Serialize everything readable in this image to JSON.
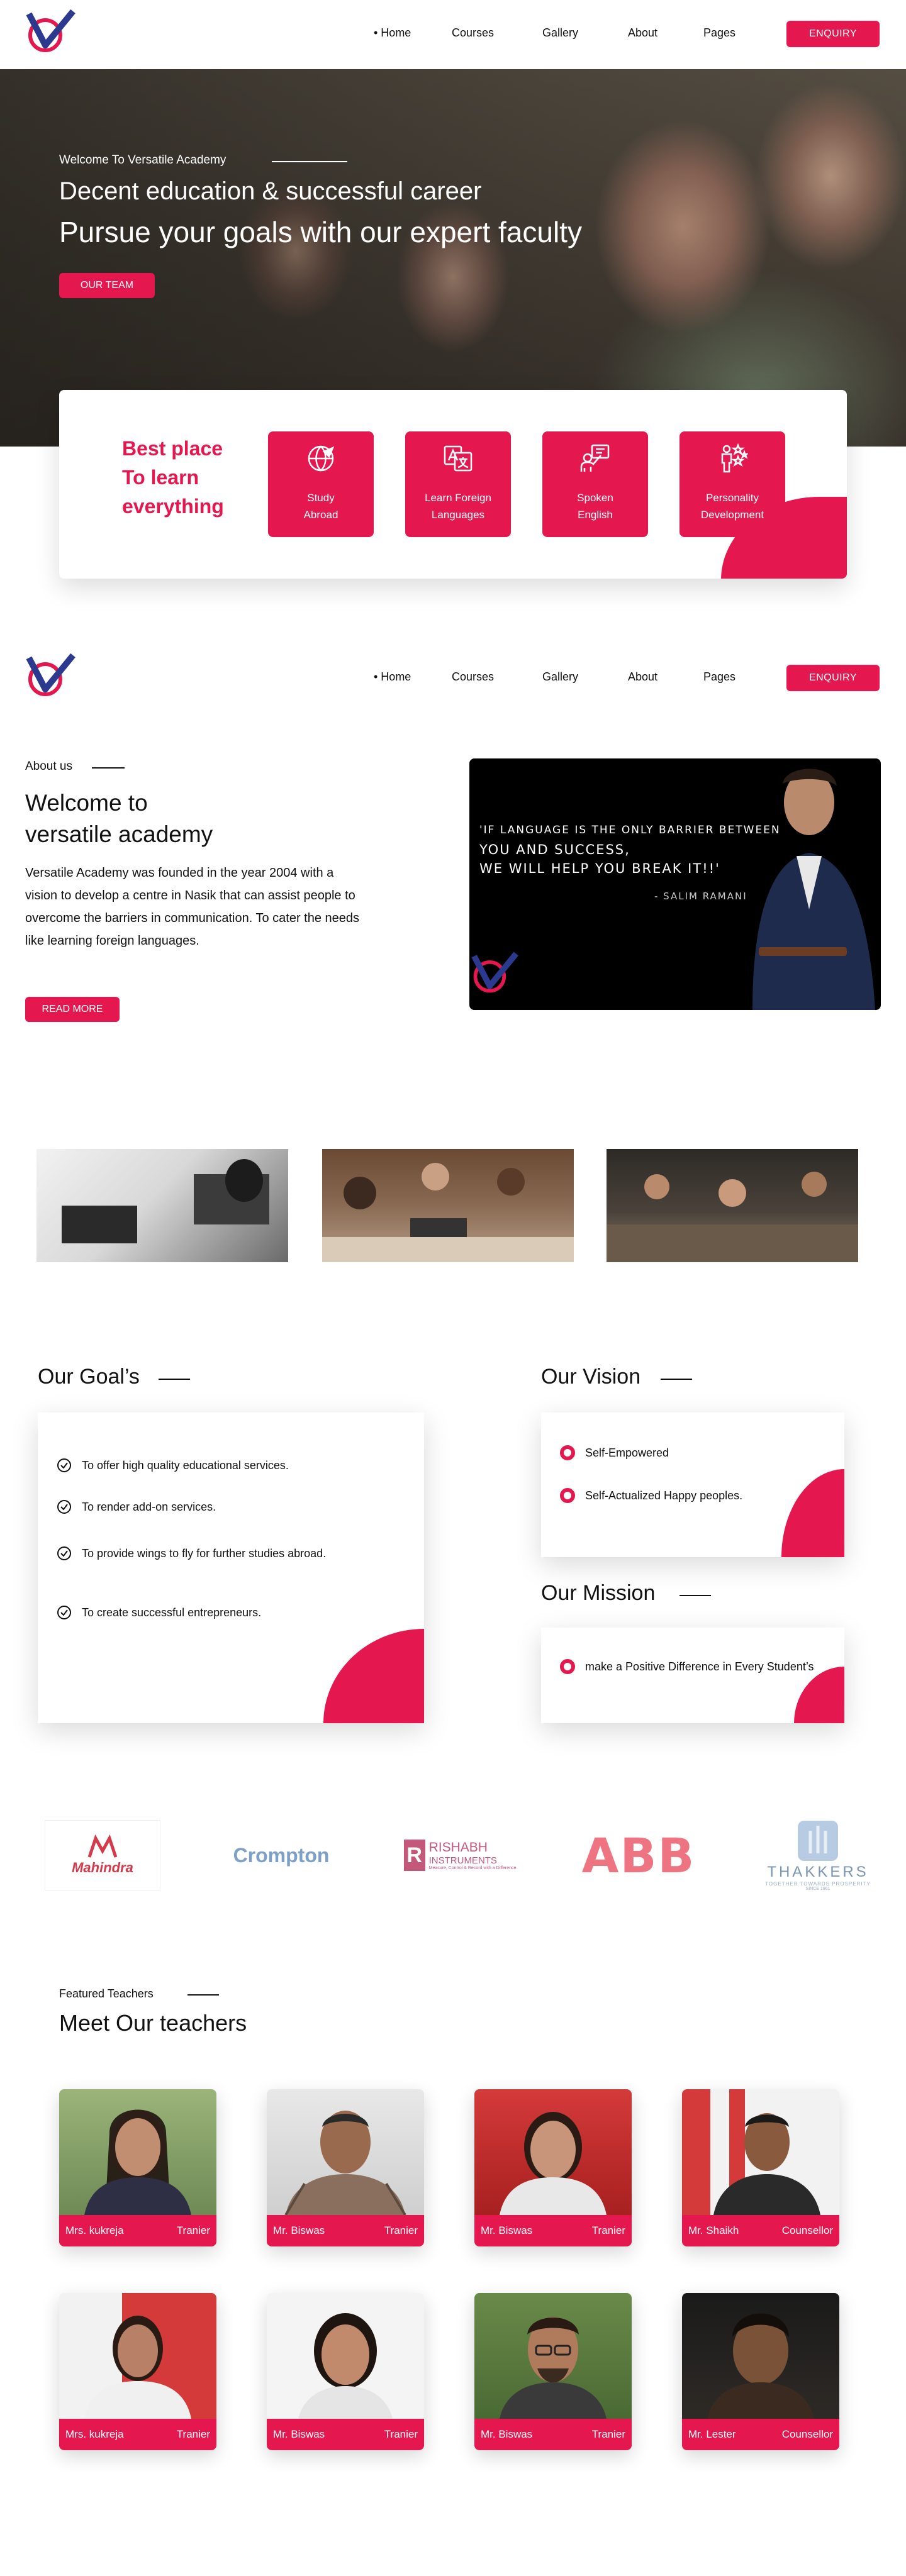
{
  "nav": {
    "items": [
      "• Home",
      "Courses",
      "Gallery",
      "About",
      "Pages"
    ],
    "enquiry": "ENQUIRY"
  },
  "hero": {
    "welcome": "Welcome To Versatile Academy",
    "heading1": "Decent education & successful career",
    "heading2": "Pursue your goals with our expert faculty",
    "button": "OUR TEAM"
  },
  "features": {
    "tagline": [
      "Best place",
      "To learn",
      "everything"
    ],
    "items": [
      {
        "line1": "Study",
        "line2": "Abroad",
        "icon": "globe-plane-icon"
      },
      {
        "line1": "Learn Foreign",
        "line2": "Languages",
        "icon": "translate-icon"
      },
      {
        "line1": "Spoken",
        "line2": "English",
        "icon": "speaker-board-icon"
      },
      {
        "line1": "Personality",
        "line2": "Development",
        "icon": "person-stars-icon"
      }
    ]
  },
  "about": {
    "label": "About us",
    "title1": "Welcome to",
    "title2": "versatile academy",
    "text": "Versatile Academy was founded in the year 2004 with a vision to develop a centre in Nasik that can assist people to overcome the barriers in communication. To cater the needs like learning foreign languages.",
    "button": "READ MORE",
    "quote": {
      "line1": "'IF LANGUAGE IS THE ONLY BARRIER BETWEEN",
      "line2": "YOU AND SUCCESS,",
      "line3": "WE WILL HELP YOU BREAK IT!!'",
      "author": "- SALIM RAMANI"
    }
  },
  "goals": {
    "title": "Our Goal’s",
    "items": [
      "To offer high quality educational services.",
      "To render add-on services.",
      "To provide wings to fly for further studies abroad.",
      "To create successful entrepreneurs."
    ]
  },
  "vision": {
    "title": "Our Vision",
    "items": [
      "Self-Empowered",
      "Self-Actualized Happy peoples."
    ]
  },
  "mission": {
    "title": "Our Mission",
    "items": [
      "make a Positive Difference in Every Student’s"
    ]
  },
  "partners": {
    "mahindra": "Mahindra",
    "crompton": "Crompton",
    "rishabh1": "RISHABH",
    "rishabh2": "INSTRUMENTS",
    "rishabh3": "Measure, Control & Record with a Difference",
    "abb": "ABB",
    "thakkers": "THAKKERS",
    "thakkers_sub": "TOGETHER TOWARDS PROSPERITY",
    "thakkers_since": "SINCE 1961"
  },
  "teachers": {
    "label": "Featured Teachers",
    "title": "Meet Our teachers",
    "list": [
      {
        "name": "Mrs. kukreja",
        "role": "Tranier"
      },
      {
        "name": "Mr. Biswas",
        "role": "Tranier"
      },
      {
        "name": "Mr. Biswas",
        "role": "Tranier"
      },
      {
        "name": "Mr. Shaikh",
        "role": "Counsellor"
      },
      {
        "name": "Mrs. kukreja",
        "role": "Tranier"
      },
      {
        "name": "Mr. Biswas",
        "role": "Tranier"
      },
      {
        "name": "Mr. Biswas",
        "role": "Tranier"
      },
      {
        "name": "Mr. Lester",
        "role": "Counsellor"
      }
    ]
  },
  "colors": {
    "accent": "#e5174f",
    "brand_blue": "#2b3a8f"
  }
}
